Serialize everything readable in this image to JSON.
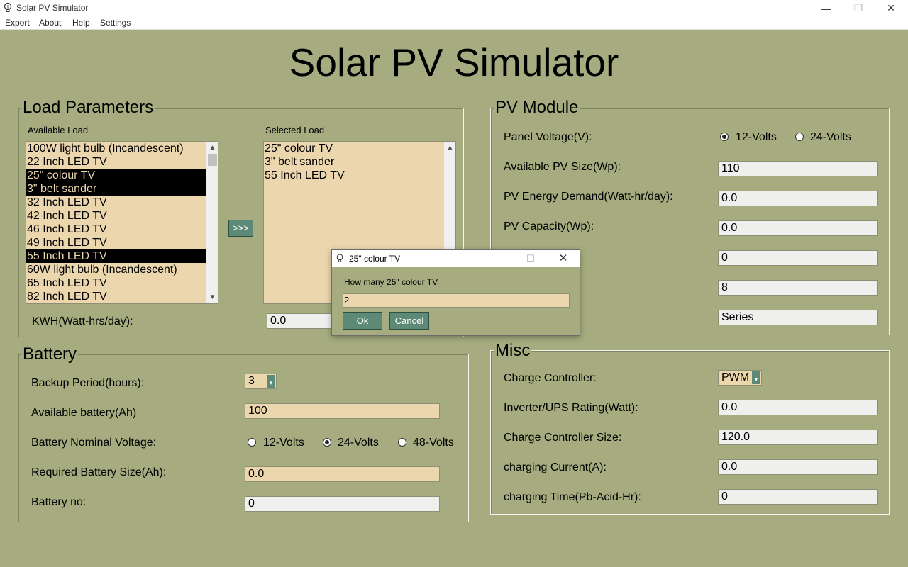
{
  "window": {
    "title": "Solar PV Simulator",
    "min_glyph": "—",
    "max_glyph": "❐",
    "close_glyph": "✕"
  },
  "menu": [
    "Export",
    "About",
    "Help",
    "Settings"
  ],
  "main_title": "Solar PV Simulator",
  "load": {
    "group_label": "Load Parameters",
    "available_label": "Available Load",
    "selected_label": "Selected Load",
    "available_items": [
      {
        "text": "100W light bulb (Incandescent)",
        "selected": false
      },
      {
        "text": "22 Inch LED TV",
        "selected": false
      },
      {
        "text": "25\" colour TV",
        "selected": true
      },
      {
        "text": "3\" belt sander",
        "selected": true
      },
      {
        "text": "32 Inch LED TV",
        "selected": false
      },
      {
        "text": "42 Inch LED TV",
        "selected": false
      },
      {
        "text": "46 Inch LED TV",
        "selected": false
      },
      {
        "text": "49 Inch LED TV",
        "selected": false
      },
      {
        "text": "55 Inch LED TV",
        "selected": true
      },
      {
        "text": "60W light bulb (Incandescent)",
        "selected": false
      },
      {
        "text": "65 Inch LED TV",
        "selected": false
      },
      {
        "text": "82 Inch LED TV",
        "selected": false
      }
    ],
    "selected_items": [
      "25\" colour TV",
      "3\" belt sander",
      "55 Inch LED TV"
    ],
    "transfer_button": ">>>",
    "kwh_label": "KWH(Watt-hrs/day):",
    "kwh_value": "0.0"
  },
  "battery": {
    "group_label": "Battery",
    "backup_label": "Backup Period(hours):",
    "backup_value": "3",
    "available_label": "Available battery(Ah)",
    "available_value": "100",
    "voltage_label": "Battery Nominal Voltage:",
    "voltage_options": [
      "12-Volts",
      "24-Volts",
      "48-Volts"
    ],
    "voltage_selected": "24-Volts",
    "required_label": "Required Battery Size(Ah):",
    "required_value": "0.0",
    "count_label": "Battery no:",
    "count_value": "0"
  },
  "pv": {
    "group_label": "PV Module",
    "panel_voltage_label": "Panel Voltage(V):",
    "panel_voltage_options": [
      "12-Volts",
      "24-Volts"
    ],
    "panel_voltage_selected": "12-Volts",
    "size_label": "Available PV Size(Wp):",
    "size_value": "110",
    "demand_label": "PV Energy Demand(Watt-hr/day):",
    "demand_value": "0.0",
    "capacity_label": "PV Capacity(Wp):",
    "capacity_value": "0.0",
    "field5_value": "0",
    "field6_value": "8",
    "field7_value": "Series"
  },
  "misc": {
    "group_label": "Misc",
    "controller_label": "Charge Controller:",
    "controller_value": "PWM",
    "inverter_label": "Inverter/UPS Rating(Watt):",
    "inverter_value": "0.0",
    "controller_size_label": "Charge Controller Size:",
    "controller_size_value": "120.0",
    "current_label": "charging Current(A):",
    "current_value": "0.0",
    "time_label": "charging Time(Pb-Acid-Hr):",
    "time_value": "0"
  },
  "dialog": {
    "title": "25\" colour TV",
    "prompt": "How many 25\" colour TV",
    "input_value": "2",
    "ok_label": "Ok",
    "cancel_label": "Cancel"
  }
}
